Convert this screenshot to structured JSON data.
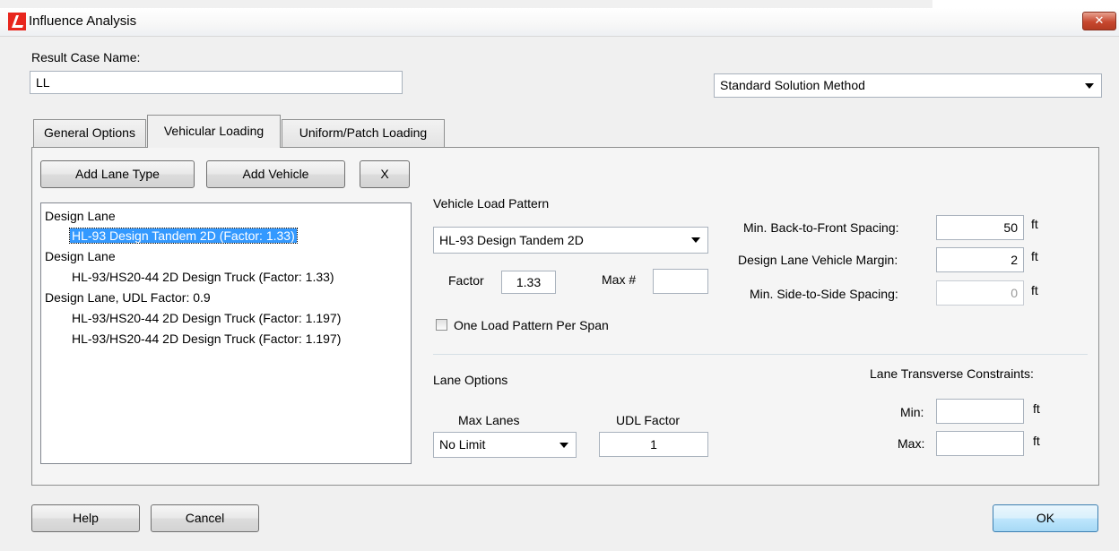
{
  "window": {
    "title": "Influence Analysis",
    "close_symbol": "✕",
    "background_text": "",
    "app_icon_color": "#e8261d"
  },
  "result_case": {
    "label": "Result Case Name:",
    "value": "LL"
  },
  "solution_method": {
    "selected": "Standard Solution Method"
  },
  "tabs": [
    {
      "label": "General Options",
      "active": false
    },
    {
      "label": "Vehicular Loading",
      "active": true
    },
    {
      "label": "Uniform/Patch Loading",
      "active": false
    }
  ],
  "toolbar": {
    "add_lane_type": "Add Lane Type",
    "add_vehicle": "Add Vehicle",
    "delete": "X"
  },
  "lane_list": [
    {
      "text": "Design Lane",
      "indent": 0,
      "selected": false
    },
    {
      "text": "HL-93 Design Tandem 2D (Factor: 1.33)",
      "indent": 1,
      "selected": true
    },
    {
      "text": "Design Lane",
      "indent": 0,
      "selected": false
    },
    {
      "text": "HL-93/HS20-44 2D Design Truck (Factor: 1.33)",
      "indent": 1,
      "selected": false
    },
    {
      "text": "Design Lane, UDL Factor: 0.9",
      "indent": 0,
      "selected": false
    },
    {
      "text": "HL-93/HS20-44 2D Design Truck (Factor: 1.197)",
      "indent": 1,
      "selected": false
    },
    {
      "text": "HL-93/HS20-44 2D Design Truck (Factor: 1.197)",
      "indent": 1,
      "selected": false
    }
  ],
  "vehicle": {
    "pattern_label": "Vehicle Load Pattern",
    "pattern_selected": "HL-93 Design Tandem 2D",
    "factor_label": "Factor",
    "factor_value": "1.33",
    "max_label": "Max #",
    "max_value": "",
    "one_pattern_label": "One Load Pattern Per Span",
    "one_pattern_checked": false
  },
  "spacing": {
    "back_to_front_label": "Min. Back-to-Front Spacing:",
    "back_to_front_value": "50",
    "margin_label": "Design Lane Vehicle Margin:",
    "margin_value": "2",
    "side_to_side_label": "Min. Side-to-Side Spacing:",
    "side_to_side_value": "0",
    "unit": "ft"
  },
  "lane_options": {
    "label": "Lane Options",
    "max_lanes_label": "Max Lanes",
    "max_lanes_value": "No Limit",
    "udl_label": "UDL Factor",
    "udl_value": "1"
  },
  "transverse": {
    "label": "Lane Transverse Constraints:",
    "min_label": "Min:",
    "min_value": "",
    "max_label": "Max:",
    "max_value": "",
    "unit": "ft"
  },
  "footer": {
    "help": "Help",
    "cancel": "Cancel",
    "ok": "OK"
  }
}
